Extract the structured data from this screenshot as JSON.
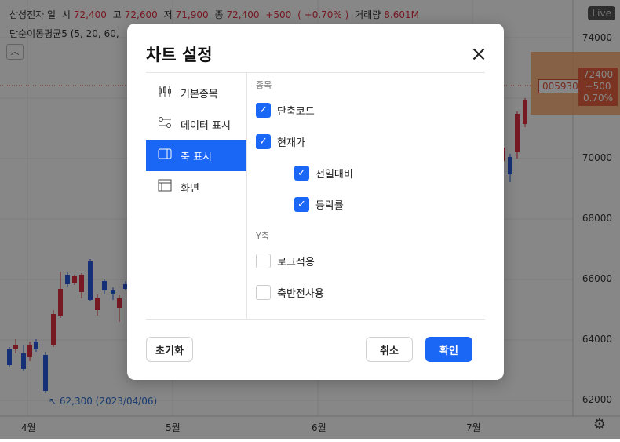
{
  "header": {
    "symbol": "삼성전자 일",
    "open_label": "시",
    "open": "72,400",
    "high_label": "고",
    "high": "72,600",
    "low_label": "저",
    "low": "71,900",
    "close_label": "종",
    "close": "72,400",
    "change": "+500",
    "change_pct": "( +0.70% )",
    "volume_label": "거래량",
    "volume": "8.601M",
    "ma": "단순이동평균5",
    "ma_params": "(5, 20, 60,",
    "live": "Live"
  },
  "y_axis": [
    "74000",
    "72000",
    "70000",
    "68000",
    "66000",
    "64000",
    "62000"
  ],
  "x_axis": [
    "4월",
    "5월",
    "6월",
    "7월"
  ],
  "price_tag": {
    "code": "005930",
    "price": "72400",
    "change": "+500",
    "pct": "0.70%"
  },
  "low_marker": "62,300 (2023/04/06)",
  "dialog": {
    "title": "차트 설정",
    "menu": [
      {
        "label": "기본종목",
        "icon": "candlestick-icon"
      },
      {
        "label": "데이터 표시",
        "icon": "sliders-icon"
      },
      {
        "label": "축 표시",
        "icon": "axis-icon"
      },
      {
        "label": "화면",
        "icon": "layout-icon"
      }
    ],
    "active_menu": "축 표시",
    "sections": {
      "stock_label": "종목",
      "stock_options": [
        {
          "label": "단축코드",
          "checked": true
        },
        {
          "label": "현재가",
          "checked": true
        },
        {
          "label": "전일대비",
          "checked": true
        },
        {
          "label": "등락률",
          "checked": true
        }
      ],
      "y_label": "Y축",
      "y_options": [
        {
          "label": "로그적용",
          "checked": false
        },
        {
          "label": "축반전사용",
          "checked": false
        }
      ]
    },
    "buttons": {
      "reset": "초기화",
      "cancel": "취소",
      "ok": "확인"
    }
  },
  "colors": {
    "accent": "#1a66f5",
    "up": "#e03040",
    "down": "#2a5ce0"
  }
}
